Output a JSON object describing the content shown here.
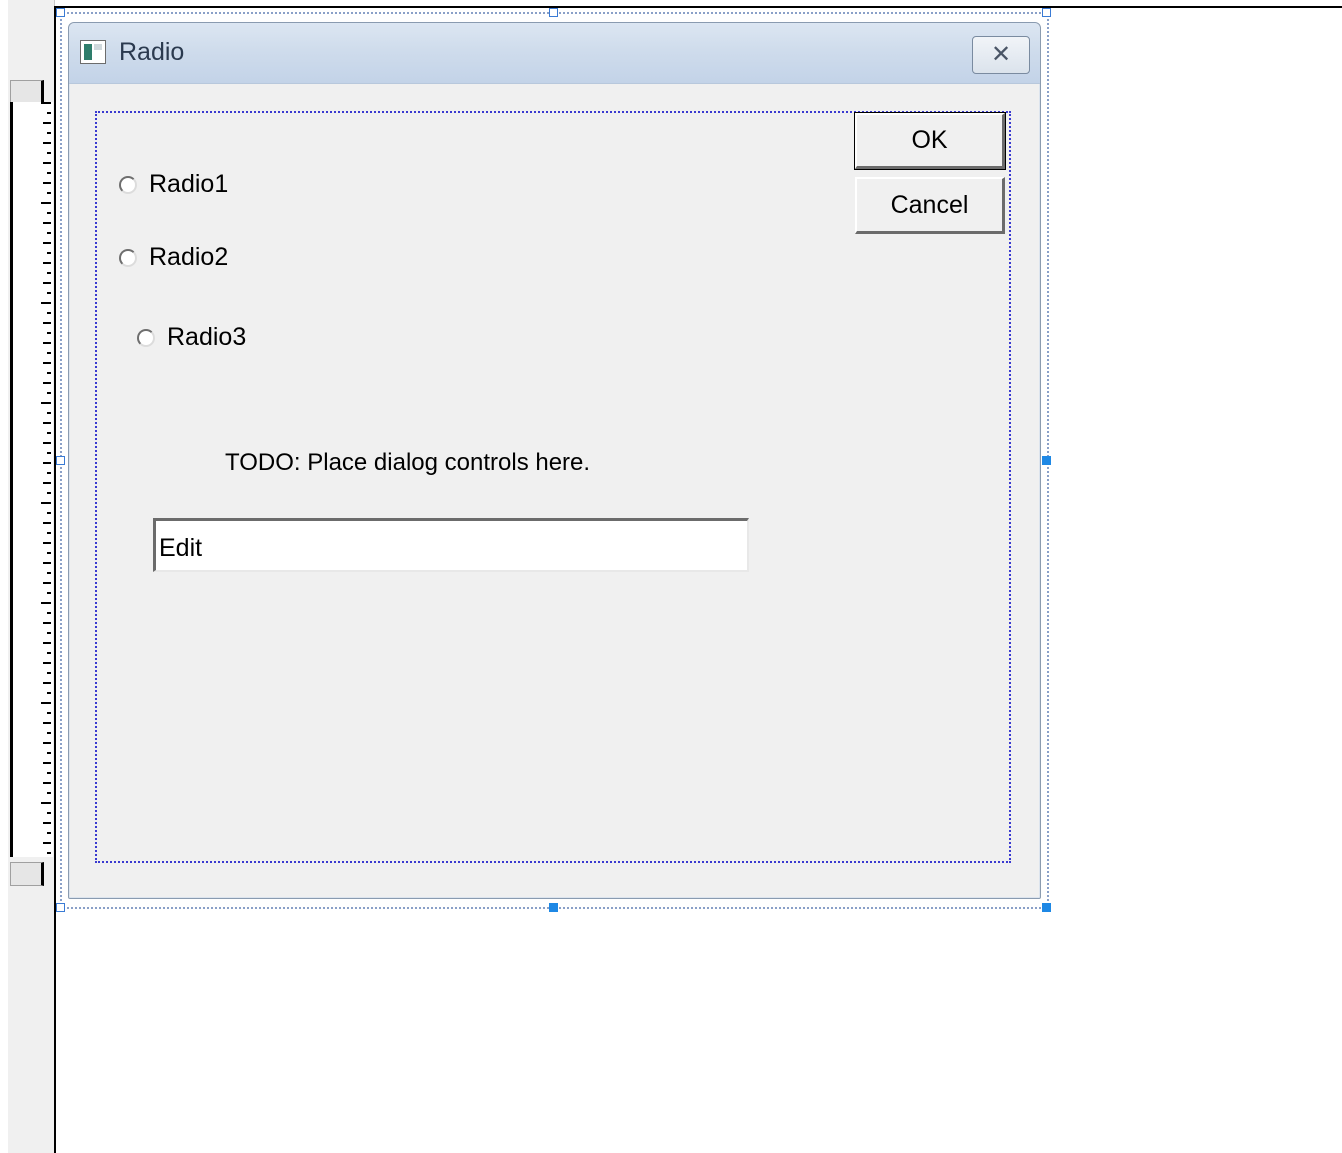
{
  "dialog": {
    "title": "Radio",
    "close_glyph": "✕",
    "app_icon": "dialog-app-icon"
  },
  "controls": {
    "radio1_label": "Radio1",
    "radio2_label": "Radio2",
    "radio3_label": "Radio3",
    "todo_text": "TODO: Place dialog controls here.",
    "edit_value": "Edit"
  },
  "buttons": {
    "ok_label": "OK",
    "cancel_label": "Cancel"
  },
  "colors": {
    "selection_handle": "#1e88e5",
    "client_guide": "#3a3ad0",
    "titlebar": "#cfdcec",
    "dialog_bg": "#f0f0f0"
  }
}
